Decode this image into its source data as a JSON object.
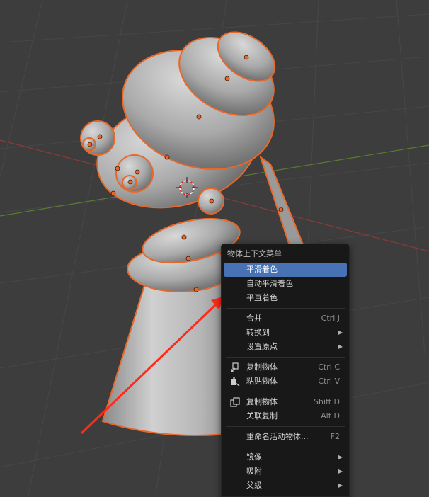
{
  "context_menu": {
    "title": "物体上下文菜单",
    "groups": [
      [
        {
          "label": "平滑着色",
          "active": true
        },
        {
          "label": "自动平滑着色"
        },
        {
          "label": "平直着色"
        }
      ],
      [
        {
          "label": "合并",
          "shortcut": "Ctrl J"
        },
        {
          "label": "转换到",
          "submenu": true
        },
        {
          "label": "设置原点",
          "submenu": true
        }
      ],
      [
        {
          "label": "复制物体",
          "shortcut": "Ctrl C",
          "icon": "copy-icon"
        },
        {
          "label": "粘贴物体",
          "shortcut": "Ctrl V",
          "icon": "paste-icon"
        }
      ],
      [
        {
          "label": "复制物体",
          "shortcut": "Shift D",
          "icon": "duplicate-icon"
        },
        {
          "label": "关联复制",
          "shortcut": "Alt D"
        }
      ],
      [
        {
          "label": "重命名活动物体...",
          "shortcut": "F2"
        }
      ],
      [
        {
          "label": "镜像",
          "submenu": true
        },
        {
          "label": "吸附",
          "submenu": true
        },
        {
          "label": "父级",
          "submenu": true
        }
      ]
    ]
  },
  "colors": {
    "viewport_bg": "#3d3d3d",
    "selection_outline": "#e8682a",
    "highlight": "#4772b3",
    "annotation_arrow": "#ff2a1a"
  }
}
